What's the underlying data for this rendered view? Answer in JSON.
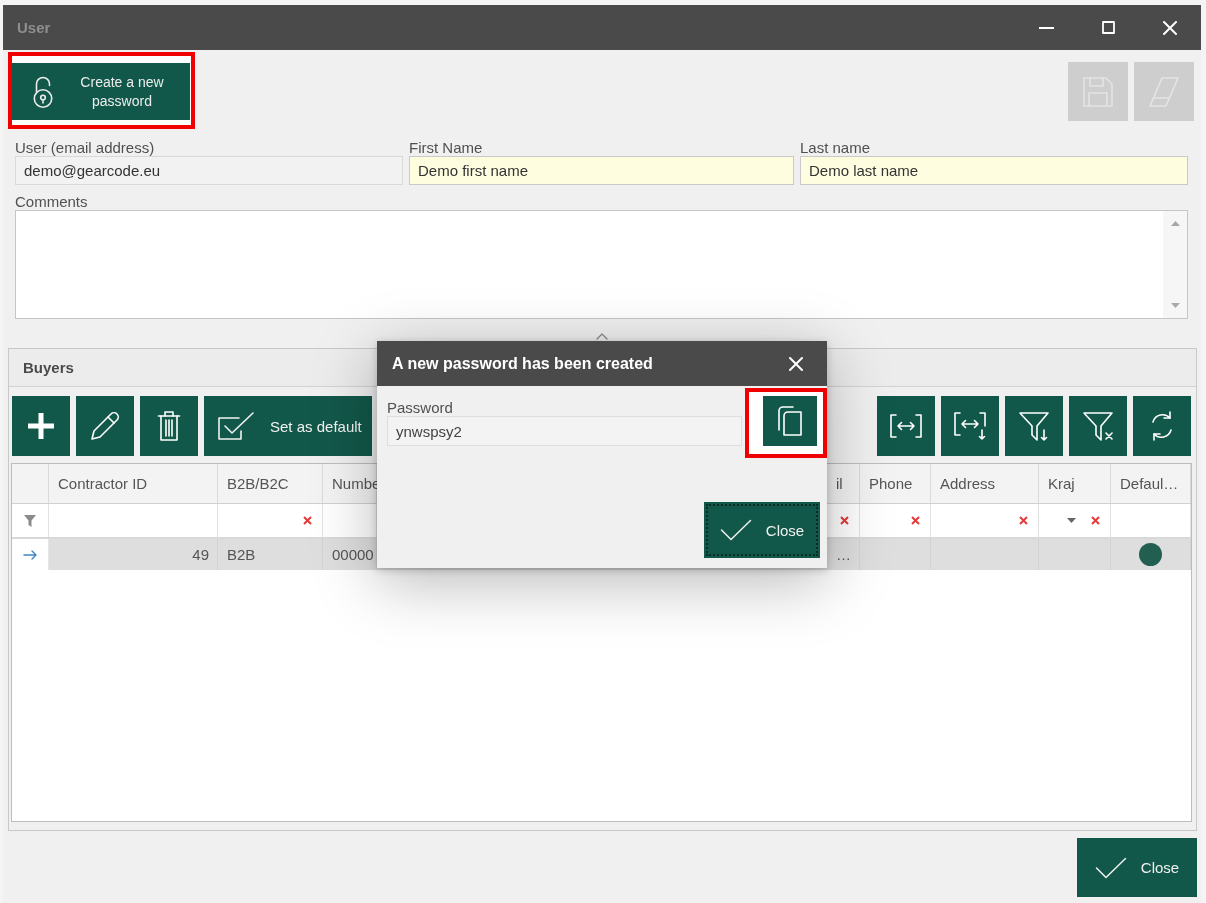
{
  "window": {
    "title": "User",
    "active": false
  },
  "toolbar": {
    "create_password": {
      "label": "Create a new password",
      "highlighted": true
    },
    "buttons": [
      {
        "kind": "save",
        "disabled": true
      },
      {
        "kind": "erase",
        "disabled": true
      }
    ]
  },
  "fields": [
    {
      "label": "User (email address)",
      "value": "demo@gearcode.eu",
      "readonly": true
    },
    {
      "label": "First Name",
      "value": "Demo first name",
      "readonly": false
    },
    {
      "label": "Last name",
      "value": "Demo last name",
      "readonly": false
    }
  ],
  "comments": {
    "label": "Comments"
  },
  "buyers": {
    "title": "Buyers",
    "actions": [
      {
        "kind": "add"
      },
      {
        "kind": "edit"
      },
      {
        "kind": "delete"
      },
      {
        "kind": "default",
        "label": "Set as default"
      }
    ],
    "tools": [
      {
        "kind": "fit"
      },
      {
        "kind": "fitdown"
      },
      {
        "kind": "filterdown"
      },
      {
        "kind": "filterclear"
      },
      {
        "kind": "refresh"
      }
    ],
    "columns": [
      {
        "label": "Contractor ID",
        "kind": "number",
        "clear_filter": false,
        "filter_dropdown": false
      },
      {
        "label": "B2B/B2C",
        "kind": "text",
        "clear_filter": true,
        "filter_dropdown": false
      },
      {
        "label": "Numbe",
        "kind": "text",
        "clear_filter": false,
        "filter_dropdown": false
      },
      {
        "label": "il",
        "kind": "text",
        "clear_filter": true,
        "filter_dropdown": false
      },
      {
        "label": "Phone",
        "kind": "text",
        "clear_filter": true,
        "filter_dropdown": false
      },
      {
        "label": "Address",
        "kind": "text",
        "clear_filter": true,
        "filter_dropdown": false
      },
      {
        "label": "Kraj",
        "kind": "text",
        "clear_filter": true,
        "filter_dropdown": true
      },
      {
        "label": "Defaul…",
        "kind": "flag",
        "clear_filter": false,
        "filter_dropdown": false
      }
    ],
    "rows": [
      {
        "selected": true,
        "cells": [
          "49",
          "B2B",
          "00000",
          "…"
        ],
        "default": true
      }
    ]
  },
  "dialog": {
    "title": "A new password has been created",
    "field": {
      "label": "Password",
      "value": "ynwspsy2"
    },
    "copy": {
      "highlighted": true
    },
    "close": {
      "label": "Close",
      "focused": true
    }
  },
  "footer": {
    "close": {
      "label": "Close"
    }
  }
}
